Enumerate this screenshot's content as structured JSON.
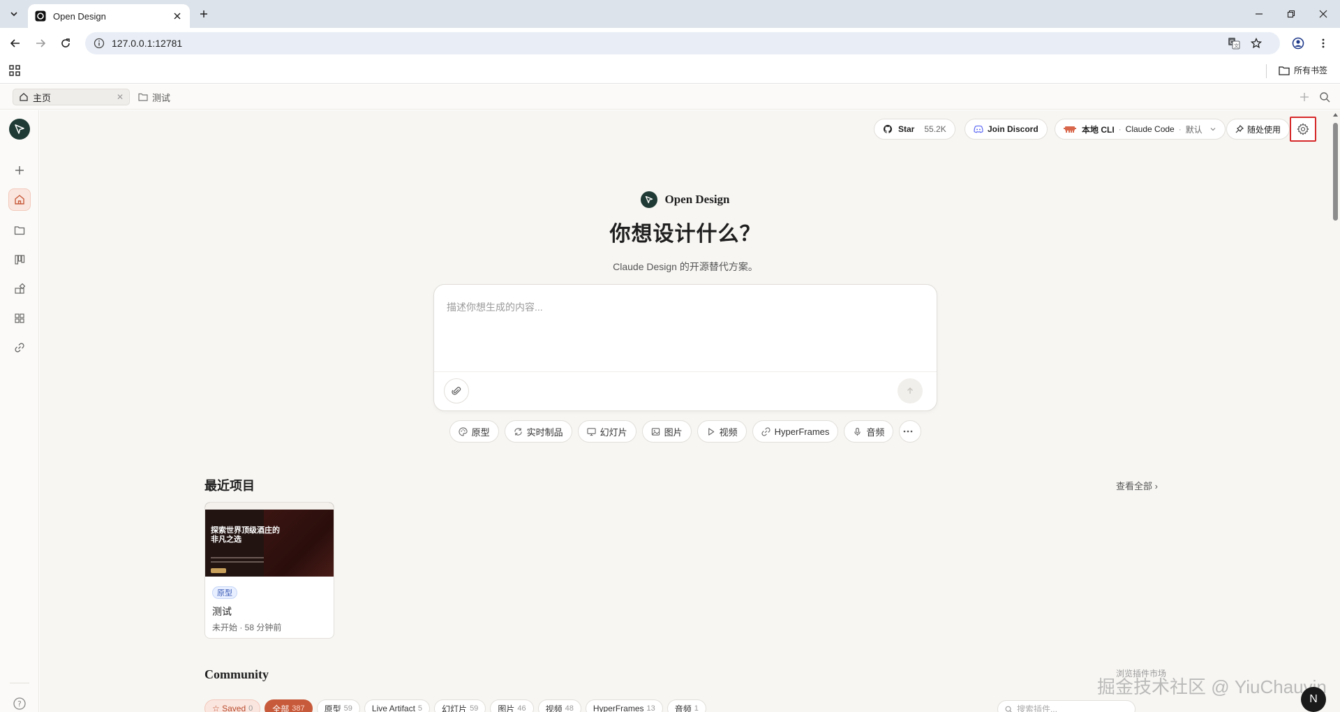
{
  "browser": {
    "tab_title": "Open Design",
    "url": "127.0.0.1:12781",
    "all_bookmarks": "所有书签"
  },
  "app_tabs": [
    {
      "label": "主页",
      "active": true
    },
    {
      "label": "测试",
      "active": false
    }
  ],
  "sidebar": {
    "items": [
      "new-icon",
      "home-icon",
      "folder-icon",
      "board-icon",
      "plugins-icon",
      "grid-icon",
      "link-icon"
    ],
    "help": "?"
  },
  "topbar": {
    "star_label": "Star",
    "star_count": "55.2K",
    "discord_label": "Join Discord",
    "cli_label": "本地 CLI",
    "cli_agent": "Claude Code",
    "cli_default": "默认",
    "use_anywhere": "随处使用"
  },
  "hero": {
    "brand": "Open Design",
    "headline": "你想设计什么？",
    "subline": "Claude Design 的开源替代方案。",
    "prompt_placeholder": "描述你想生成的内容..."
  },
  "modes": [
    {
      "label": "原型",
      "icon": "palette-icon"
    },
    {
      "label": "实时制品",
      "icon": "refresh-icon"
    },
    {
      "label": "幻灯片",
      "icon": "monitor-icon"
    },
    {
      "label": "图片",
      "icon": "image-icon"
    },
    {
      "label": "视频",
      "icon": "play-icon"
    },
    {
      "label": "HyperFrames",
      "icon": "link-icon"
    },
    {
      "label": "音频",
      "icon": "mic-icon"
    }
  ],
  "recent": {
    "title": "最近项目",
    "view_all": "查看全部 ›",
    "projects": [
      {
        "thumb_heading": "探索世界顶级酒庄的非凡之选",
        "tag": "原型",
        "name": "测试",
        "meta": "未开始 · 58 分钟前"
      }
    ]
  },
  "community": {
    "title": "Community",
    "filters": [
      {
        "label": "☆ Saved",
        "count": "0",
        "style": "saved"
      },
      {
        "label": "全部",
        "count": "387",
        "style": "active"
      },
      {
        "label": "原型",
        "count": "59",
        "style": ""
      },
      {
        "label": "Live Artifact",
        "count": "5",
        "style": ""
      },
      {
        "label": "幻灯片",
        "count": "59",
        "style": ""
      },
      {
        "label": "图片",
        "count": "46",
        "style": ""
      },
      {
        "label": "视频",
        "count": "48",
        "style": ""
      },
      {
        "label": "HyperFrames",
        "count": "13",
        "style": ""
      },
      {
        "label": "音频",
        "count": "1",
        "style": ""
      }
    ],
    "search_placeholder": "搜索插件..."
  },
  "watermark": {
    "small": "浏览插件市场",
    "main": "掘金技术社区 @ YiuChauvin"
  },
  "user_avatar": "N",
  "colors": {
    "accent": "#c75a3a",
    "brand_dark": "#1f3a34",
    "highlight_box": "#d62828"
  }
}
